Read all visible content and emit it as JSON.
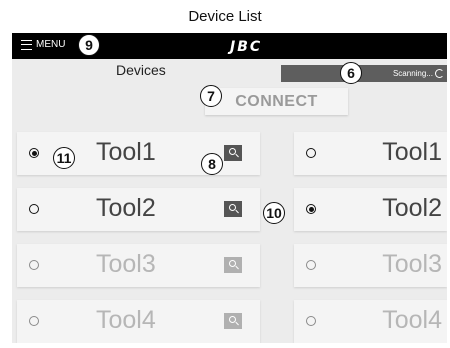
{
  "doc_title": "Device List",
  "topbar": {
    "menu_label": "MENU",
    "logo": "JBC"
  },
  "section_title": "Devices",
  "scan_status": "Scanning...",
  "connect_label": "CONNECT",
  "left_tools": [
    {
      "label": "Tool1",
      "selected": true,
      "enabled": true
    },
    {
      "label": "Tool2",
      "selected": false,
      "enabled": true
    },
    {
      "label": "Tool3",
      "selected": false,
      "enabled": false
    },
    {
      "label": "Tool4",
      "selected": false,
      "enabled": false
    }
  ],
  "right_tools": [
    {
      "label": "Tool1",
      "selected": false,
      "enabled": true
    },
    {
      "label": "Tool2",
      "selected": true,
      "enabled": true
    },
    {
      "label": "Tool3",
      "selected": false,
      "enabled": false
    },
    {
      "label": "Tool4",
      "selected": false,
      "enabled": false
    }
  ],
  "callouts": {
    "menu": "9",
    "scan": "6",
    "connect": "7",
    "search": "8",
    "right_radio": "10",
    "left_radio": "11"
  },
  "icons": {
    "menu": "hamburger-icon",
    "search": "search-icon",
    "scan": "refresh-icon"
  },
  "colors": {
    "topbar": "#000000",
    "screen_bg": "#ececec",
    "scanbar": "#5e5e5e",
    "search_button": "#555555"
  }
}
